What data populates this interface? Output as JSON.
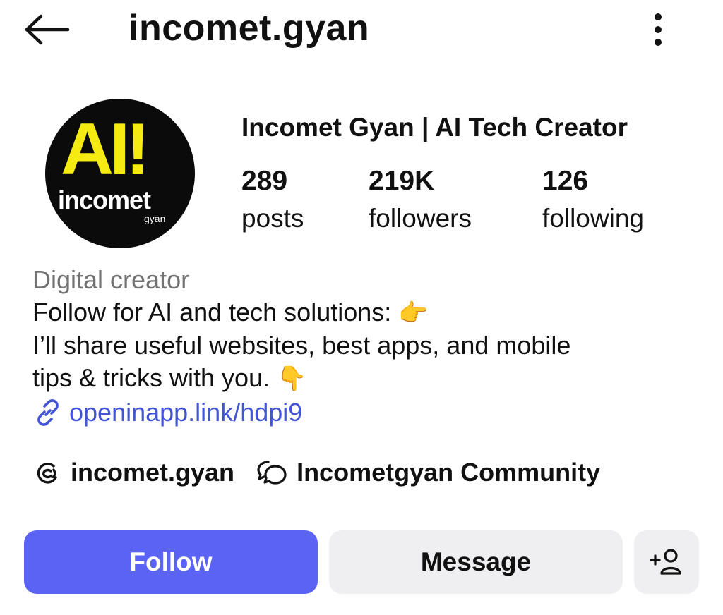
{
  "header": {
    "username": "incomet.gyan",
    "back_icon": "arrow-left-icon",
    "more_icon": "vertical-dots-icon"
  },
  "profile": {
    "avatar": {
      "logo_text": "AI!",
      "logo_word": "incomet",
      "logo_sub": "gyan",
      "logo_color": "#f5ea11",
      "background": "#0b0b0b"
    },
    "display_name": "Incomet Gyan | AI Tech Creator",
    "stats": [
      {
        "value": "289",
        "label": "posts"
      },
      {
        "value": "219K",
        "label": "followers"
      },
      {
        "value": "126",
        "label": "following"
      }
    ]
  },
  "bio": {
    "category": "Digital creator",
    "lines": [
      "Follow for AI and tech solutions:",
      "I’ll share useful websites, best apps, and mobile",
      "tips & tricks with you."
    ],
    "emojis": [
      "👉",
      "👇"
    ],
    "link_icon": "link-icon",
    "link": "openinapp.link/hdpi9",
    "link_color": "#4355d6"
  },
  "social": {
    "threads": {
      "icon": "threads-icon",
      "label": "incomet.gyan"
    },
    "community": {
      "icon": "chat-bubbles-icon",
      "label": "Incometgyan Community"
    }
  },
  "actions": {
    "follow_label": "Follow",
    "message_label": "Message",
    "suggest_icon": "add-person-icon",
    "follow_color": "#5b63f5",
    "secondary_color": "#efeff1"
  }
}
